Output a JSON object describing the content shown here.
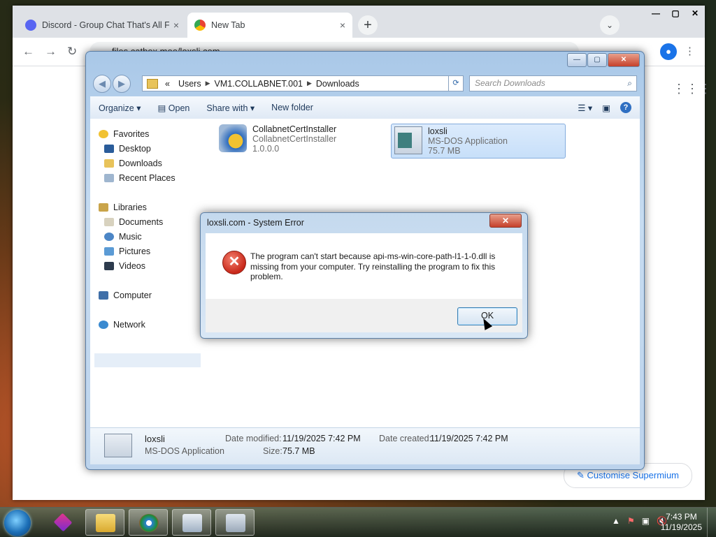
{
  "browser": {
    "tabs": [
      {
        "title": "Discord - Group Chat That's All Fun & Games",
        "close": "×"
      },
      {
        "title": "New Tab",
        "close": "×"
      }
    ],
    "new_tab": "+",
    "tab_search": "⌄",
    "window_controls": {
      "minimize": "—",
      "maximize": "▢",
      "close": "✕"
    },
    "nav": {
      "back": "←",
      "forward": "→",
      "reload": "↻"
    },
    "url": "files.catbox.moe/loxsli.com",
    "apps_grid": "⋮⋮⋮",
    "menu": "⋮",
    "customise_label": "Customise Supermium"
  },
  "explorer": {
    "caption": {
      "minimize": "—",
      "maximize": "▢",
      "close": "✕"
    },
    "back": "◀",
    "forward": "▶",
    "address": {
      "prefix": "«",
      "path": [
        "Users",
        "VM1.COLLABNET.001",
        "Downloads"
      ],
      "sep": "▶",
      "dropdown": "▼"
    },
    "refresh": "⟳",
    "search_placeholder": "Search Downloads",
    "toolbar": {
      "organize": "Organize ▾",
      "open": "Open",
      "share_with": "Share with ▾",
      "new_folder": "New folder",
      "views": "▾",
      "help": "?"
    },
    "nav_items": [
      {
        "label": "Favorites",
        "icon": "star-icon"
      },
      {
        "label": "Desktop",
        "icon": "desktop-icon"
      },
      {
        "label": "Downloads",
        "icon": "downloads-folder-icon"
      },
      {
        "label": "Recent Places",
        "icon": "recent-places-icon"
      },
      {
        "label": "Libraries",
        "icon": "libraries-icon"
      },
      {
        "label": "Documents",
        "icon": "documents-icon"
      },
      {
        "label": "Music",
        "icon": "music-icon"
      },
      {
        "label": "Pictures",
        "icon": "pictures-icon"
      },
      {
        "label": "Videos",
        "icon": "videos-icon"
      },
      {
        "label": "Computer",
        "icon": "computer-icon"
      },
      {
        "label": "Network",
        "icon": "network-icon"
      }
    ],
    "files": [
      {
        "name": "CollabnetCertInstaller",
        "line2": "CollabnetCertInstaller",
        "line3": "1.0.0.0",
        "icon": "installer-icon"
      },
      {
        "name": "loxsli",
        "line2": "MS-DOS Application",
        "line3": "75.7 MB",
        "icon": "msdos-app-icon"
      }
    ],
    "details": {
      "name": "loxsli",
      "type": "MS-DOS Application",
      "date_modified_label": "Date modified:",
      "date_modified": "11/19/2025 7:42 PM",
      "date_created_label": "Date created:",
      "date_created": "11/19/2025 7:42 PM",
      "size_label": "Size:",
      "size": "75.7 MB"
    }
  },
  "dialog": {
    "title": "loxsli.com - System Error",
    "close": "✕",
    "icon": "error-icon",
    "message": "The program can't start because api-ms-win-core-path-l1-1-0.dll is missing from your computer. Try reinstalling the program to fix this problem.",
    "ok_label": "OK"
  },
  "taskbar": {
    "apps": [
      "start-orb",
      "app-launcher",
      "windows-explorer",
      "chromium-browser",
      "loxsli-window",
      "error-dialog-window"
    ],
    "tray": {
      "arrow": "▲",
      "flag": "⚑",
      "network": "▣",
      "volume": "🔇"
    },
    "time": "7:43 PM",
    "date": "11/19/2025"
  },
  "colors": {
    "accent": "#1a73e8",
    "error_red": "#c8281a",
    "aero_blue": "#bcd3ec"
  }
}
